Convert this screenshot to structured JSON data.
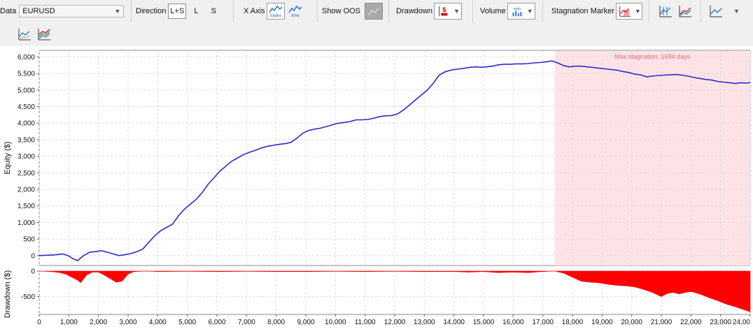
{
  "toolbar": {
    "data_label": "Data",
    "data_value": "EURUSD",
    "direction_label": "Direction",
    "direction_options": [
      "L+S",
      "L",
      "S"
    ],
    "direction_selected": "L+S",
    "xaxis_label": "X Axis",
    "xaxis_trades": "trades",
    "xaxis_time": "time",
    "show_oos_label": "Show OOS",
    "drawdown_label": "Drawdown",
    "drawdown_icon": "$",
    "volume_label": "Volume",
    "volume_icon": "auto",
    "stagnation_label": "Stagnation Marker",
    "icons": {
      "drawdown": "drawdown-dollar-icon",
      "volume": "volume-auto-icon",
      "stagnation": "stagnation-marker-icon",
      "chart_a": "chart-type-a-icon",
      "chart_b": "chart-type-b-icon",
      "chart_c": "chart-type-c-icon",
      "chart_d": "chart-scatter-icon",
      "chart_e": "chart-multiline-icon"
    },
    "colors": {
      "accent": "#1a6fc9",
      "drawdown": "#ff0000"
    }
  },
  "chart_data": [
    {
      "type": "line",
      "ylabel": "Equity ($)",
      "xlim": [
        0,
        24000
      ],
      "ylim": [
        -300,
        6200
      ],
      "x_ticks": [
        0,
        1000,
        2000,
        3000,
        4000,
        5000,
        6000,
        7000,
        8000,
        9000,
        10000,
        11000,
        12000,
        13000,
        14000,
        15000,
        16000,
        17000,
        18000,
        19000,
        20000,
        21000,
        22000,
        23000,
        24000
      ],
      "x_tick_labels": [
        "0",
        "1,000",
        "2,000",
        "3,000",
        "4,000",
        "5,000",
        "6,000",
        "7,000",
        "8,000",
        "9,000",
        "10,000",
        "11,000",
        "12,000",
        "13,000",
        "14,000",
        "15,000",
        "16,000",
        "17,000",
        "18,000",
        "19,000",
        "20,000",
        "21,000",
        "22,000",
        "23,000",
        "24,00"
      ],
      "y_ticks": [
        0,
        500,
        1000,
        1500,
        2000,
        2500,
        3000,
        3500,
        4000,
        4500,
        5000,
        5500,
        6000
      ],
      "y_tick_labels": [
        "0",
        "500",
        "1,000",
        "1,500",
        "2,000",
        "2,500",
        "3,000",
        "3,500",
        "4,000",
        "4,500",
        "5,000",
        "5,500",
        "6,000"
      ],
      "grid": true,
      "line_color": "#2a2acc",
      "stagnation": {
        "label": "Max stagnation: 1694 days",
        "x_start": 17400,
        "x_end": 24000,
        "color": "#fde3e6"
      },
      "series": [
        {
          "x": [
            0,
            500,
            800,
            1000,
            1150,
            1300,
            1500,
            1700,
            1900,
            2100,
            2300,
            2500,
            2700,
            2900,
            3100,
            3300,
            3500,
            3700,
            3900,
            4100,
            4300,
            4500,
            4700,
            4900,
            5100,
            5300,
            5500,
            5700,
            5900,
            6100,
            6300,
            6500,
            6700,
            6900,
            7100,
            7300,
            7500,
            7700,
            7900,
            8100,
            8300,
            8500,
            8700,
            8900,
            9100,
            9300,
            9500,
            9700,
            9900,
            10100,
            10300,
            10500,
            10700,
            10900,
            11100,
            11300,
            11500,
            11700,
            11900,
            12100,
            12300,
            12500,
            12700,
            12900,
            13100,
            13300,
            13500,
            13700,
            13900,
            14100,
            14300,
            14500,
            14700,
            14900,
            15100,
            15300,
            15500,
            15700,
            15900,
            16100,
            16300,
            16500,
            16700,
            16900,
            17100,
            17300,
            17500,
            17700,
            17900,
            18100,
            18300,
            18500,
            18700,
            18900,
            19100,
            19300,
            19500,
            19700,
            19900,
            20100,
            20300,
            20500,
            20700,
            20900,
            21100,
            21300,
            21500,
            21700,
            21900,
            22100,
            22300,
            22500,
            22700,
            22900,
            23100,
            23300,
            23500,
            23700,
            23900,
            24000
          ],
          "values": [
            0,
            20,
            50,
            -10,
            -100,
            -150,
            0,
            100,
            120,
            150,
            100,
            50,
            0,
            30,
            60,
            120,
            200,
            400,
            600,
            750,
            850,
            950,
            1200,
            1400,
            1550,
            1700,
            1900,
            2150,
            2350,
            2550,
            2700,
            2850,
            2950,
            3050,
            3120,
            3180,
            3250,
            3300,
            3330,
            3360,
            3380,
            3420,
            3550,
            3700,
            3780,
            3820,
            3850,
            3900,
            3950,
            4000,
            4020,
            4050,
            4100,
            4100,
            4110,
            4150,
            4200,
            4220,
            4230,
            4280,
            4400,
            4550,
            4700,
            4850,
            5000,
            5200,
            5450,
            5550,
            5600,
            5630,
            5650,
            5680,
            5700,
            5690,
            5700,
            5720,
            5760,
            5780,
            5780,
            5790,
            5790,
            5800,
            5820,
            5830,
            5850,
            5880,
            5820,
            5740,
            5700,
            5720,
            5720,
            5700,
            5680,
            5660,
            5640,
            5620,
            5600,
            5560,
            5530,
            5480,
            5460,
            5400,
            5420,
            5440,
            5450,
            5460,
            5470,
            5450,
            5420,
            5380,
            5350,
            5320,
            5300,
            5260,
            5240,
            5220,
            5200,
            5220,
            5210,
            5230
          ]
        }
      ]
    },
    {
      "type": "area",
      "ylabel": "Drawdown ($)",
      "xlim": [
        0,
        24000
      ],
      "ylim": [
        -850,
        0
      ],
      "y_ticks": [
        0,
        -500
      ],
      "y_tick_labels": [
        "0",
        "-500"
      ],
      "grid": true,
      "fill_color": "#ff0000",
      "series": [
        {
          "x": [
            0,
            400,
            700,
            900,
            1100,
            1300,
            1400,
            1600,
            1800,
            2000,
            2200,
            2400,
            2600,
            2800,
            3000,
            3200,
            3400,
            3600,
            4000,
            5000,
            6000,
            7000,
            8000,
            9000,
            10000,
            11000,
            12000,
            13000,
            14000,
            14500,
            15000,
            15500,
            16000,
            16500,
            17000,
            17400,
            17700,
            18000,
            18300,
            18600,
            18900,
            19200,
            19500,
            19800,
            20100,
            20400,
            20700,
            21000,
            21200,
            21400,
            21600,
            21800,
            22000,
            22300,
            22600,
            22900,
            23200,
            23500,
            23800,
            24000
          ],
          "values": [
            0,
            -10,
            -30,
            -60,
            -120,
            -180,
            -230,
            -80,
            -20,
            -20,
            -80,
            -150,
            -220,
            -200,
            -60,
            -10,
            -5,
            0,
            -10,
            -5,
            -10,
            -5,
            -10,
            -10,
            -5,
            -10,
            -5,
            -10,
            -10,
            -20,
            -10,
            -30,
            -20,
            -30,
            -10,
            0,
            -40,
            -120,
            -200,
            -220,
            -230,
            -260,
            -280,
            -290,
            -310,
            -360,
            -420,
            -500,
            -440,
            -420,
            -450,
            -420,
            -400,
            -450,
            -520,
            -580,
            -650,
            -700,
            -760,
            -800
          ]
        }
      ]
    }
  ]
}
